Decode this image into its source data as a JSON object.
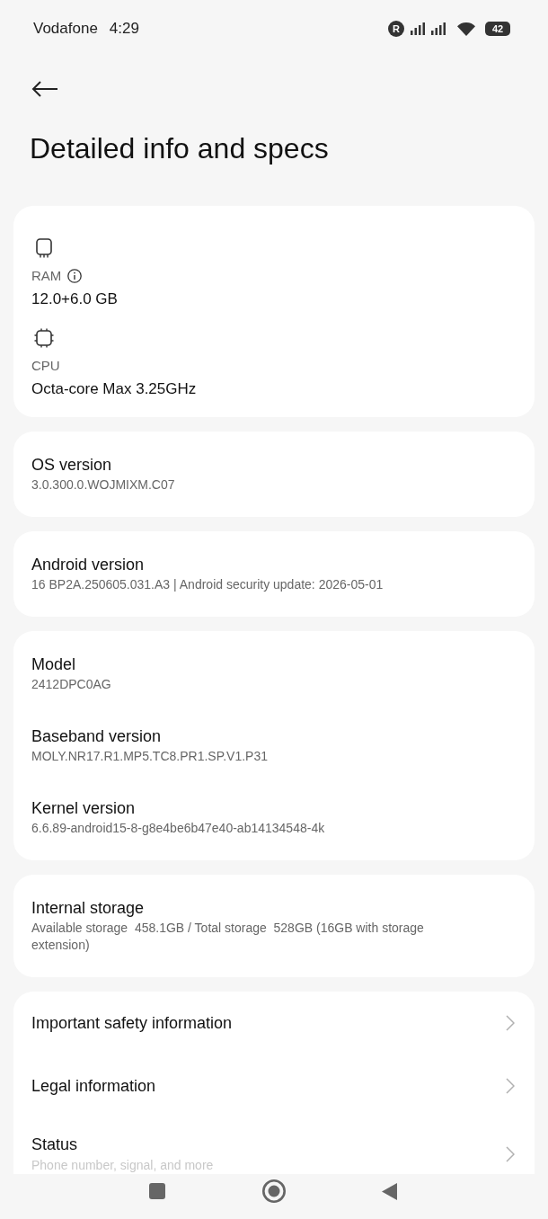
{
  "status_bar": {
    "carrier": "Vodafone",
    "time": "4:29",
    "roaming": "R",
    "battery": "42"
  },
  "header": {
    "title": "Detailed info and specs"
  },
  "cards": [
    {
      "kind": "specs",
      "items": [
        {
          "kind": "memory",
          "label": "RAM",
          "info_icon": true,
          "value": "12.0+6.0 GB"
        },
        {
          "kind": "processor",
          "label": "CPU",
          "info_icon": false,
          "value": "Octa-core Max 3.25GHz"
        }
      ]
    },
    {
      "kind": "details",
      "items": [
        {
          "title": "OS version",
          "value": "3.0.300.0.WOJMIXM.C07"
        }
      ]
    },
    {
      "kind": "details",
      "items": [
        {
          "title": "Android version",
          "value": "16 BP2A.250605.031.A3 | Android security update: 2026-05-01"
        }
      ]
    },
    {
      "kind": "details",
      "items": [
        {
          "title": "Model",
          "value": "2412DPC0AG"
        },
        {
          "title": "Baseband version",
          "value": "MOLY.NR17.R1.MP5.TC8.PR1.SP.V1.P31"
        },
        {
          "title": "Kernel version",
          "value": "6.6.89-android15-8-g8e4be6b47e40-ab14134548-4k"
        }
      ]
    },
    {
      "kind": "details",
      "items": [
        {
          "title": "Internal storage",
          "value": "Available storage  458.1GB / Total storage  528GB (16GB with storage extension)"
        }
      ]
    },
    {
      "kind": "links",
      "items": [
        {
          "title": "Important safety information"
        },
        {
          "title": "Legal information"
        },
        {
          "title": "Status",
          "subtitle": "Phone number, signal, and more"
        }
      ]
    }
  ]
}
